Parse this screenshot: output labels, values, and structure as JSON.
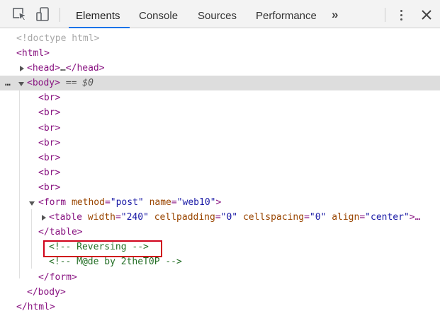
{
  "toolbar": {
    "inspect_icon": "inspect-cursor-icon",
    "device_icon": "device-toggle-icon",
    "tabs": [
      "Elements",
      "Console",
      "Sources",
      "Performance"
    ],
    "active_tab": "Elements",
    "more_tabs_label": "»",
    "menu_icon": "kebab-menu-icon",
    "close_icon": "close-icon",
    "accent_color": "#1a73e8"
  },
  "tree": {
    "doctype": "<!doctype html>",
    "html_open": "<html>",
    "head_open": "<head>",
    "head_ellipsis": "…",
    "head_close": "</head>",
    "body_open": "<body>",
    "body_selected_marker": "== $0",
    "body_dots": "…",
    "br": "<br>",
    "form_tag_open": "<form",
    "form_attr1_name": "method",
    "form_attr1_value": "\"post\"",
    "form_attr2_name": "name",
    "form_attr2_value": "\"web10\"",
    "form_tag_end": ">",
    "table_tag_open": "<table",
    "table_attr1_name": "width",
    "table_attr1_value": "\"240\"",
    "table_attr2_name": "cellpadding",
    "table_attr2_value": "\"0\"",
    "table_attr3_name": "cellspacing",
    "table_attr3_value": "\"0\"",
    "table_attr4_name": "align",
    "table_attr4_value": "\"center\"",
    "table_tag_end": ">…",
    "table_close": "</table>",
    "comment1": "<!-- Reversing -->",
    "comment2": "<!-- M@de by 2theT0P -->",
    "form_close": "</form>",
    "body_close": "</body>",
    "html_close": "</html>",
    "highlight_color": "#d0021b"
  }
}
